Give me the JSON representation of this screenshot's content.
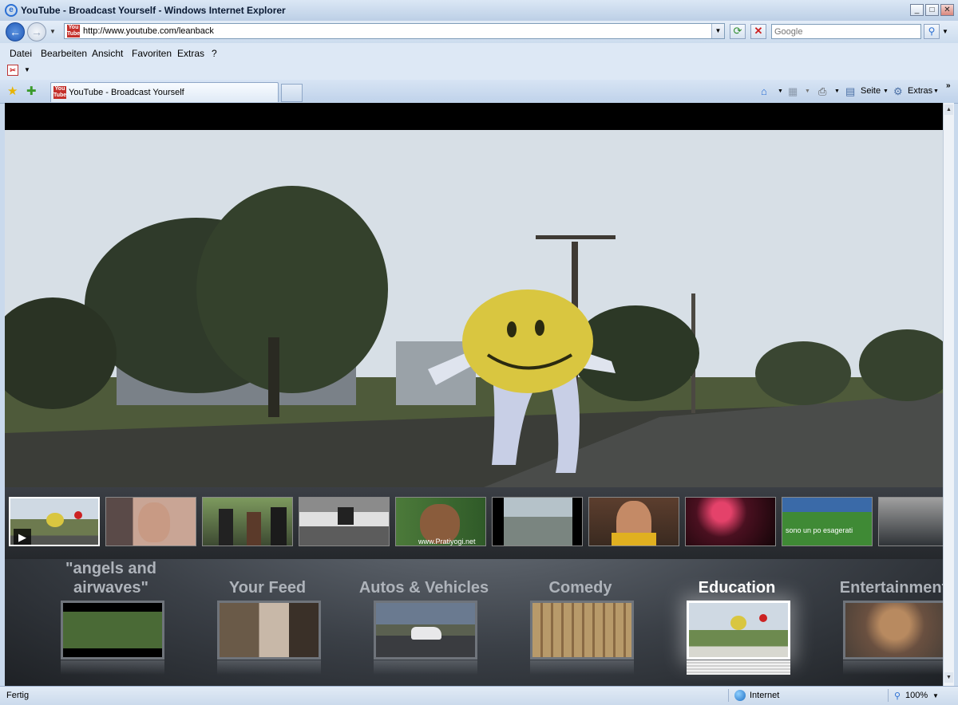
{
  "window": {
    "title": "YouTube - Broadcast Yourself - Windows Internet Explorer",
    "buttons": {
      "minimize": "_",
      "maximize": "□",
      "close": "✕"
    }
  },
  "address": {
    "url": "http://www.youtube.com/leanback",
    "search_placeholder": "Google"
  },
  "menu": [
    "Datei",
    "Bearbeiten",
    "Ansicht",
    "Favoriten",
    "Extras",
    "?"
  ],
  "tab": {
    "label": "YouTube - Broadcast Yourself"
  },
  "toolbar": {
    "page": "Seite",
    "tools": "Extras"
  },
  "categories": [
    {
      "label": "\"angels and airwaves\""
    },
    {
      "label": "Your Feed"
    },
    {
      "label": "Autos & Vehicles"
    },
    {
      "label": "Comedy"
    },
    {
      "label": "Education"
    },
    {
      "label": "Entertainment"
    }
  ],
  "thumbnail_captions": {
    "pratiyogi": "www.Pratiyogi.net",
    "italian": "sono un po esagerati"
  },
  "status": {
    "text": "Fertig",
    "zone": "Internet",
    "zoom": "100%"
  },
  "colors": {
    "ie_blue": "#2b6fd3",
    "youtube_red": "#c4302b"
  }
}
